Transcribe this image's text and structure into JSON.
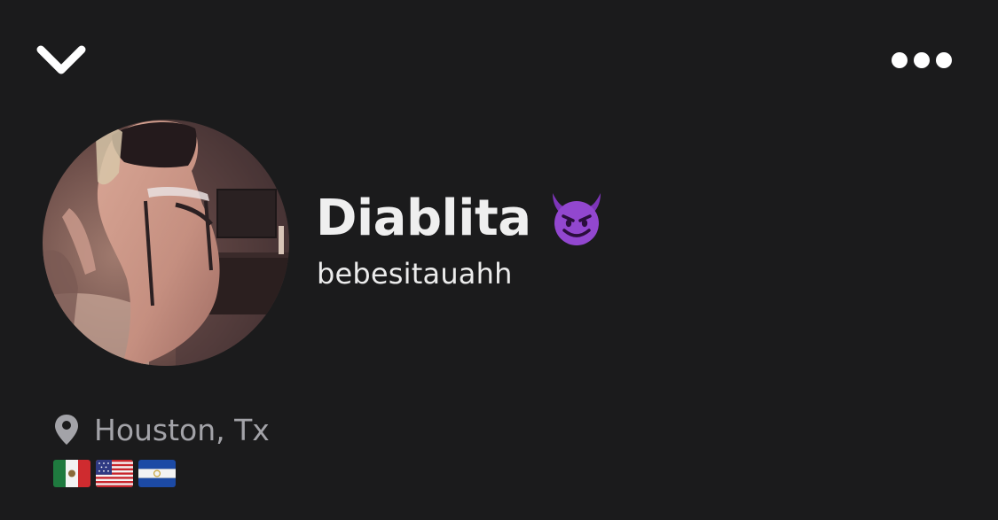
{
  "header": {
    "collapse_icon": "chevron-down-icon",
    "more_icon": "more-dots-icon"
  },
  "profile": {
    "display_name": "Diablita",
    "display_name_emoji": "smiling-face-with-horns",
    "username": "bebesitauahh",
    "location": "Houston, Tx",
    "location_icon": "location-pin-icon",
    "flags": [
      "mexico-flag",
      "usa-flag",
      "el-salvador-flag"
    ]
  },
  "colors": {
    "background": "#1b1b1c",
    "primary_text": "#efefef",
    "secondary_text": "#a3a3a8",
    "emoji_purple": "#8e44c8"
  }
}
